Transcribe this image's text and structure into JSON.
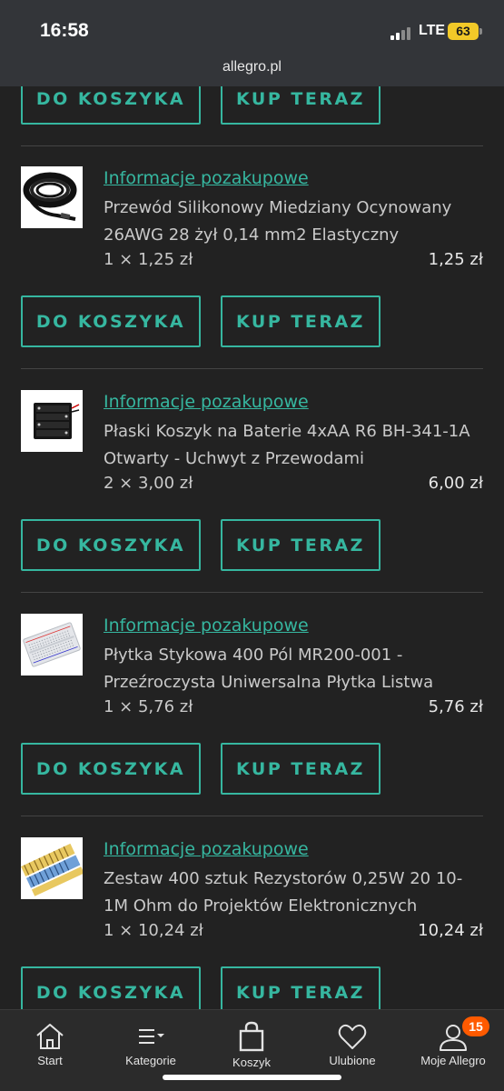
{
  "status_bar": {
    "time": "16:58",
    "network": "LTE",
    "battery": "63",
    "url": "allegro.pl"
  },
  "buttons": {
    "add_to_cart": "DO KOSZYKA",
    "buy_now": "KUP TERAZ"
  },
  "items": [
    {
      "link": "Informacje pozakupowe",
      "title": "Przewód Silikonowy Miedziany Ocynowany 26AWG 28 żył 0,14 mm2 Elastyczny",
      "qty": "1 × 1,25 zł",
      "total": "1,25 zł",
      "image": "black-cable-coil"
    },
    {
      "link": "Informacje pozakupowe",
      "title": "Płaski Koszyk na Baterie 4xAA R6 BH-341-1A Otwarty - Uchwyt z Przewodami",
      "qty": "2 × 3,00 zł",
      "total": "6,00 zł",
      "image": "battery-holder"
    },
    {
      "link": "Informacje pozakupowe",
      "title": "Płytka Stykowa 400 Pól MR200-001 - Przeźroczysta Uniwersalna Płytka Listwa",
      "qty": "1 × 5,76 zł",
      "total": "5,76 zł",
      "image": "breadboard"
    },
    {
      "link": "Informacje pozakupowe",
      "title": "Zestaw 400 sztuk Rezystorów 0,25W 20 10-1M Ohm do Projektów Elektronicznych",
      "qty": "1 × 10,24 zł",
      "total": "10,24 zł",
      "image": "resistor-set"
    }
  ],
  "nav": {
    "start": "Start",
    "categories": "Kategorie",
    "cart": "Koszyk",
    "favorites": "Ulubione",
    "my_allegro": "Moje Allegro",
    "my_allegro_badge": "15"
  },
  "colors": {
    "accent": "#36b7a0",
    "background": "#222222",
    "badge": "#ff5a00"
  }
}
